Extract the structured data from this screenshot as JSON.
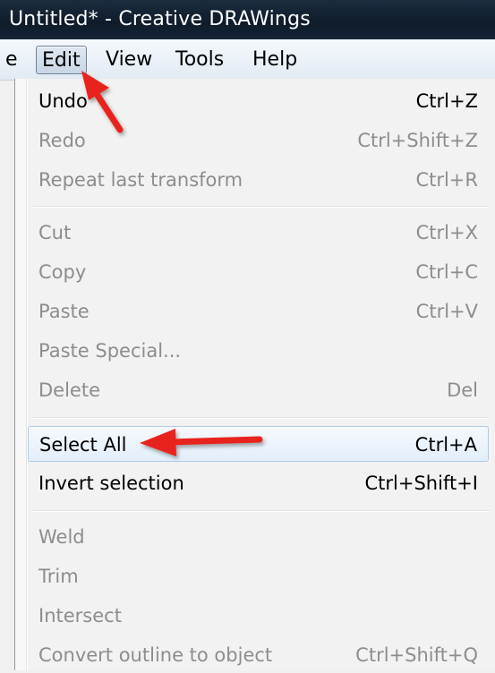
{
  "window": {
    "title": "Untitled* - Creative DRAWings"
  },
  "menubar": {
    "items": [
      {
        "label": "e"
      },
      {
        "label": "Edit",
        "active": true
      },
      {
        "label": "View"
      },
      {
        "label": "Tools"
      },
      {
        "label": "Help"
      }
    ]
  },
  "edit_menu": {
    "items": [
      {
        "label": "Undo",
        "shortcut": "Ctrl+Z",
        "enabled": true
      },
      {
        "label": "Redo",
        "shortcut": "Ctrl+Shift+Z",
        "enabled": false
      },
      {
        "label": "Repeat last transform",
        "shortcut": "Ctrl+R",
        "enabled": false
      },
      {
        "label": "Cut",
        "shortcut": "Ctrl+X",
        "enabled": false
      },
      {
        "label": "Copy",
        "shortcut": "Ctrl+C",
        "enabled": false
      },
      {
        "label": "Paste",
        "shortcut": "Ctrl+V",
        "enabled": false
      },
      {
        "label": "Paste Special...",
        "shortcut": "",
        "enabled": false
      },
      {
        "label": "Delete",
        "shortcut": "Del",
        "enabled": false
      },
      {
        "label": "Select All",
        "shortcut": "Ctrl+A",
        "enabled": true,
        "highlighted": true
      },
      {
        "label": "Invert selection",
        "shortcut": "Ctrl+Shift+I",
        "enabled": true
      },
      {
        "label": "Weld",
        "shortcut": "",
        "enabled": false
      },
      {
        "label": "Trim",
        "shortcut": "",
        "enabled": false
      },
      {
        "label": "Intersect",
        "shortcut": "",
        "enabled": false
      },
      {
        "label": "Convert outline to object",
        "shortcut": "Ctrl+Shift+Q",
        "enabled": false
      }
    ]
  },
  "annotations": {
    "arrow_color": "#e8221c"
  }
}
